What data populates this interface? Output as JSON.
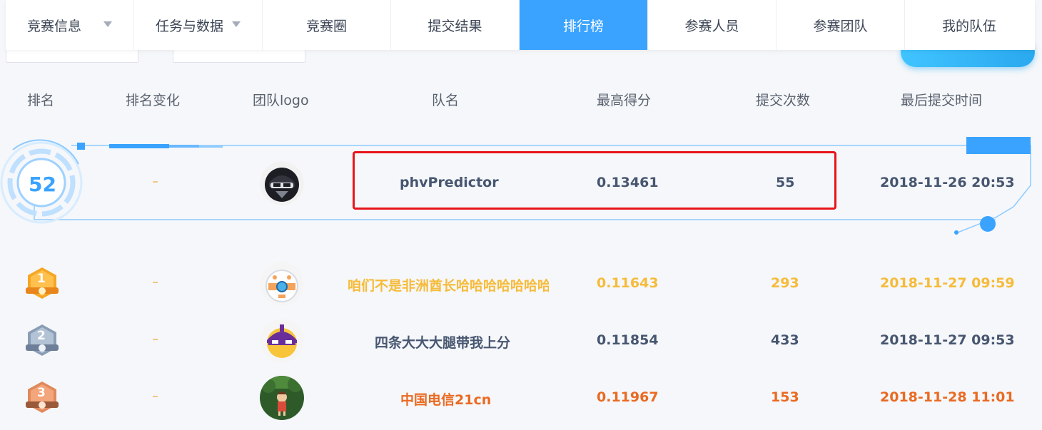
{
  "nav": {
    "tabs": [
      {
        "label": "竞赛信息",
        "dropdown": true,
        "active": false
      },
      {
        "label": "任务与数据",
        "dropdown": true,
        "active": false
      },
      {
        "label": "竞赛圈",
        "dropdown": false,
        "active": false
      },
      {
        "label": "提交结果",
        "dropdown": false,
        "active": false
      },
      {
        "label": "排行榜",
        "dropdown": false,
        "active": true
      },
      {
        "label": "参赛人员",
        "dropdown": false,
        "active": false
      },
      {
        "label": "参赛团队",
        "dropdown": false,
        "active": false
      },
      {
        "label": "我的队伍",
        "dropdown": false,
        "active": false
      }
    ]
  },
  "table": {
    "headers": {
      "rank": "排名",
      "change": "排名变化",
      "logo": "团队logo",
      "team": "队名",
      "best_score": "最高得分",
      "submissions": "提交次数",
      "last_submit": "最后提交时间"
    },
    "my_team": {
      "rank": "52",
      "change": "-",
      "team": "phvPredictor",
      "best_score": "0.13461",
      "submissions": "55",
      "last_submit": "2018-11-26 20:53"
    },
    "rows": [
      {
        "rank": "1",
        "change": "-",
        "team": "咱们不是非洲酋长哈哈哈哈哈哈哈",
        "best_score": "0.11643",
        "submissions": "293",
        "last_submit": "2018-11-27 09:59"
      },
      {
        "rank": "2",
        "change": "-",
        "team": "四条大大大腿带我上分",
        "best_score": "0.11854",
        "submissions": "433",
        "last_submit": "2018-11-27 09:53"
      },
      {
        "rank": "3",
        "change": "-",
        "team": "中国电信21cn",
        "best_score": "0.11967",
        "submissions": "153",
        "last_submit": "2018-11-28 11:01"
      }
    ]
  },
  "colors": {
    "accent": "#3aa3ff",
    "gold": "#f6bb3a",
    "silver": "#475670",
    "bronze": "#ea6a22",
    "highlight": "#e8141a"
  }
}
